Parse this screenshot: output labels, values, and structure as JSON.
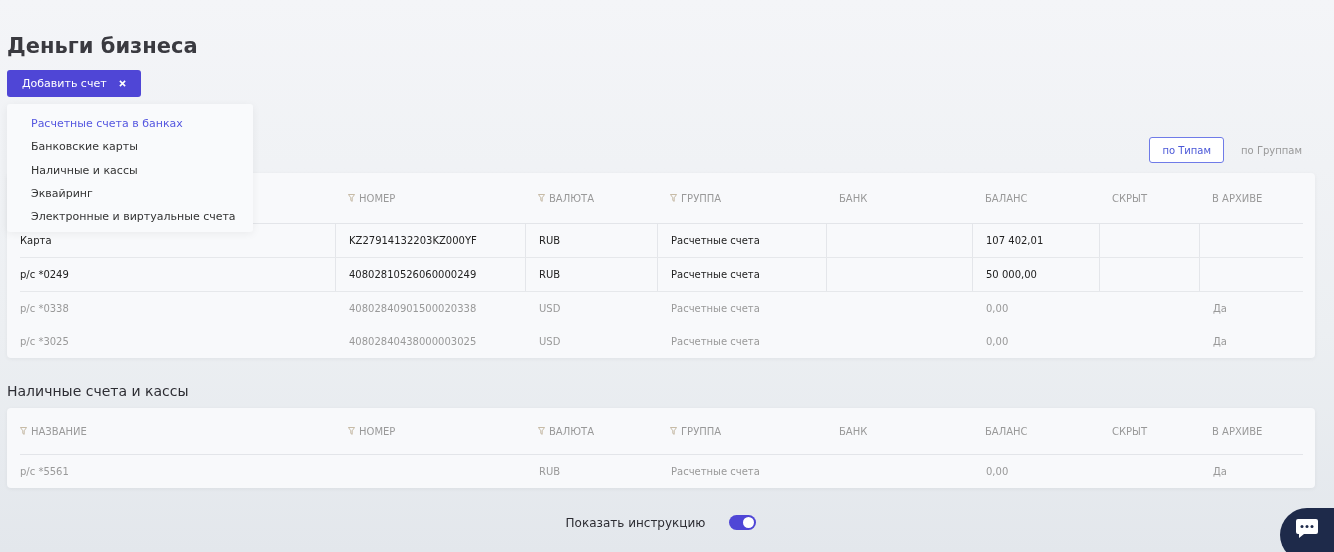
{
  "page": {
    "title": "Деньги бизнеса"
  },
  "add_button": {
    "label": "Добавить счет"
  },
  "add_menu": {
    "items": [
      {
        "label": "Расчетные счета в банках",
        "selected": true
      },
      {
        "label": "Банковские карты",
        "selected": false
      },
      {
        "label": "Наличные и кассы",
        "selected": false
      },
      {
        "label": "Эквайринг",
        "selected": false
      },
      {
        "label": "Электронные и виртуальные счета",
        "selected": false
      }
    ]
  },
  "view_toggle": [
    {
      "label": "по Типам",
      "selected": true
    },
    {
      "label": "по Группам",
      "selected": false
    }
  ],
  "sections": [
    {
      "columns": [
        {},
        {
          "label": "НОМЕР",
          "filter": true
        },
        {
          "label": "ВАЛЮТА",
          "filter": true
        },
        {
          "label": "ГРУППА",
          "filter": true
        },
        {
          "label": "БАНК",
          "filter": false
        },
        {
          "label": "БАЛАНС",
          "filter": false
        },
        {
          "label": "СКРЫТ",
          "filter": false
        },
        {
          "label": "В АРХИВЕ",
          "filter": false
        }
      ],
      "rows": [
        {
          "muted": false,
          "cells": [
            "Карта",
            "KZ27914132203KZ000YF",
            "RUB",
            "Расчетные счета",
            "",
            "107 402,01",
            "",
            ""
          ]
        },
        {
          "muted": false,
          "cells": [
            "р/с *0249",
            "40802810526060000249",
            "RUB",
            "Расчетные счета",
            "",
            "50 000,00",
            "",
            ""
          ]
        },
        {
          "muted": true,
          "cells": [
            "р/с *0338",
            "40802840901500020338",
            "USD",
            "Расчетные счета",
            "",
            "0,00",
            "",
            "Да"
          ]
        },
        {
          "muted": true,
          "cells": [
            "р/с *3025",
            "40802840438000003025",
            "USD",
            "Расчетные счета",
            "",
            "0,00",
            "",
            "Да"
          ]
        }
      ]
    },
    {
      "title": "Наличные счета и кассы",
      "columns": [
        {
          "label": "НАЗВАНИЕ",
          "filter": true
        },
        {
          "label": "НОМЕР",
          "filter": true
        },
        {
          "label": "ВАЛЮТА",
          "filter": true
        },
        {
          "label": "ГРУППА",
          "filter": true
        },
        {
          "label": "БАНК",
          "filter": false
        },
        {
          "label": "БАЛАНС",
          "filter": false
        },
        {
          "label": "СКРЫТ",
          "filter": false
        },
        {
          "label": "В АРХИВЕ",
          "filter": false
        }
      ],
      "rows": [
        {
          "muted": true,
          "cells": [
            "р/с *5561",
            "",
            "RUB",
            "Расчетные счета",
            "",
            "0,00",
            "",
            "Да"
          ]
        }
      ]
    }
  ],
  "instruction": {
    "label": "Показать инструкцию",
    "on": true
  }
}
